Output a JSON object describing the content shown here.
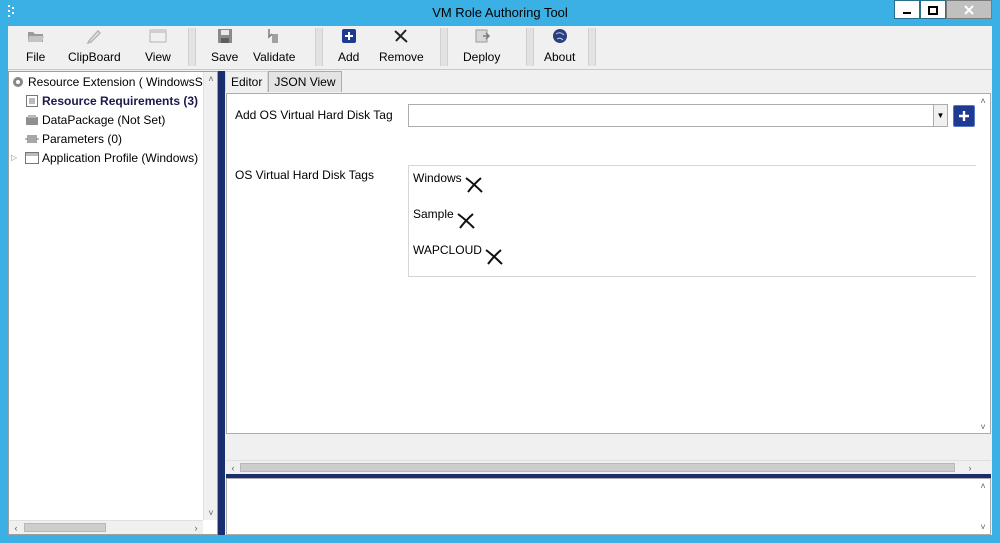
{
  "window": {
    "title": "VM Role Authoring Tool"
  },
  "toolbar": {
    "items": [
      {
        "label": "File",
        "icon": "folder-icon"
      },
      {
        "label": "ClipBoard",
        "icon": "pencil-icon"
      },
      {
        "label": "View",
        "icon": "view-window-icon"
      },
      {
        "label": "Save",
        "icon": "floppy-disk-icon"
      },
      {
        "label": "Validate",
        "icon": "validate-icon"
      },
      {
        "label": "Add",
        "icon": "add-icon"
      },
      {
        "label": "Remove",
        "icon": "remove-x-icon"
      },
      {
        "label": "Deploy",
        "icon": "deploy-icon"
      },
      {
        "label": "About",
        "icon": "about-globe-icon"
      }
    ]
  },
  "tree": {
    "items": [
      {
        "label": "Resource Extension ( WindowsSa",
        "icon": "gear-icon"
      },
      {
        "label": "Resource Requirements (3)",
        "icon": "list-icon"
      },
      {
        "label": "DataPackage (Not Set)",
        "icon": "package-icon"
      },
      {
        "label": "Parameters (0)",
        "icon": "parameters-icon"
      },
      {
        "label": "Application Profile (Windows)",
        "icon": "profile-icon"
      }
    ]
  },
  "tabs": [
    {
      "label": "Editor"
    },
    {
      "label": "JSON View"
    }
  ],
  "editor": {
    "add_tag_label": "Add OS Virtual Hard Disk Tag",
    "add_tag_value": "",
    "tags_label": "OS Virtual Hard Disk Tags",
    "tags": [
      "Windows",
      "Sample",
      "WAPCLOUD"
    ]
  },
  "colors": {
    "title_bar": "#3ab0e4",
    "splitter": "#1a2e6e",
    "add_button": "#1f3a93"
  }
}
